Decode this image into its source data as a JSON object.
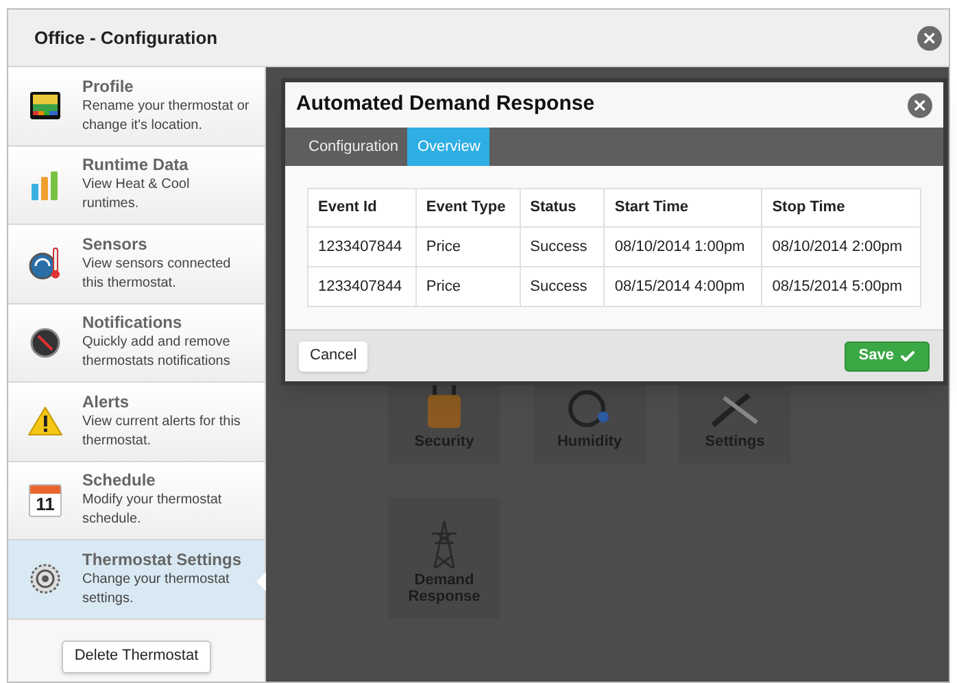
{
  "window": {
    "title": "Office - Configuration"
  },
  "sidebar": {
    "items": [
      {
        "kind": "profile",
        "title": "Profile",
        "description": "Rename your thermostat or change it's location.",
        "selected": false
      },
      {
        "kind": "runtime",
        "title": "Runtime Data",
        "description": "View Heat & Cool runtimes.",
        "selected": false
      },
      {
        "kind": "sensors",
        "title": "Sensors",
        "description": "View sensors connected this thermostat.",
        "selected": false
      },
      {
        "kind": "notifications",
        "title": "Notifications",
        "description": "Quickly add and remove thermostats notifications",
        "selected": false
      },
      {
        "kind": "alerts",
        "title": "Alerts",
        "description": "View current alerts for this thermostat.",
        "selected": false
      },
      {
        "kind": "schedule",
        "title": "Schedule",
        "description": "Modify your thermostat schedule.",
        "icon_text": "11",
        "selected": false
      },
      {
        "kind": "settings",
        "title": "Thermostat Settings",
        "description": "Change your thermostat settings.",
        "selected": true
      }
    ],
    "delete_button": "Delete Thermostat"
  },
  "tiles": [
    {
      "kind": "security",
      "label": "Security"
    },
    {
      "kind": "humidity",
      "label": "Humidity"
    },
    {
      "kind": "settings",
      "label": "Settings"
    },
    {
      "kind": "demand",
      "label": "Demand Response"
    }
  ],
  "dialog": {
    "title": "Automated Demand Response",
    "tabs": [
      {
        "label": "Configuration",
        "selected": false
      },
      {
        "label": "Overview",
        "selected": true
      }
    ],
    "table": {
      "columns": [
        "Event Id",
        "Event Type",
        "Status",
        "Start Time",
        "Stop Time"
      ],
      "rows": [
        [
          "1233407844",
          "Price",
          "Success",
          "08/10/2014 1:00pm",
          "08/10/2014 2:00pm"
        ],
        [
          "1233407844",
          "Price",
          "Success",
          "08/15/2014 4:00pm",
          "08/15/2014 5:00pm"
        ]
      ]
    },
    "cancel_button": "Cancel",
    "save_button": "Save"
  }
}
